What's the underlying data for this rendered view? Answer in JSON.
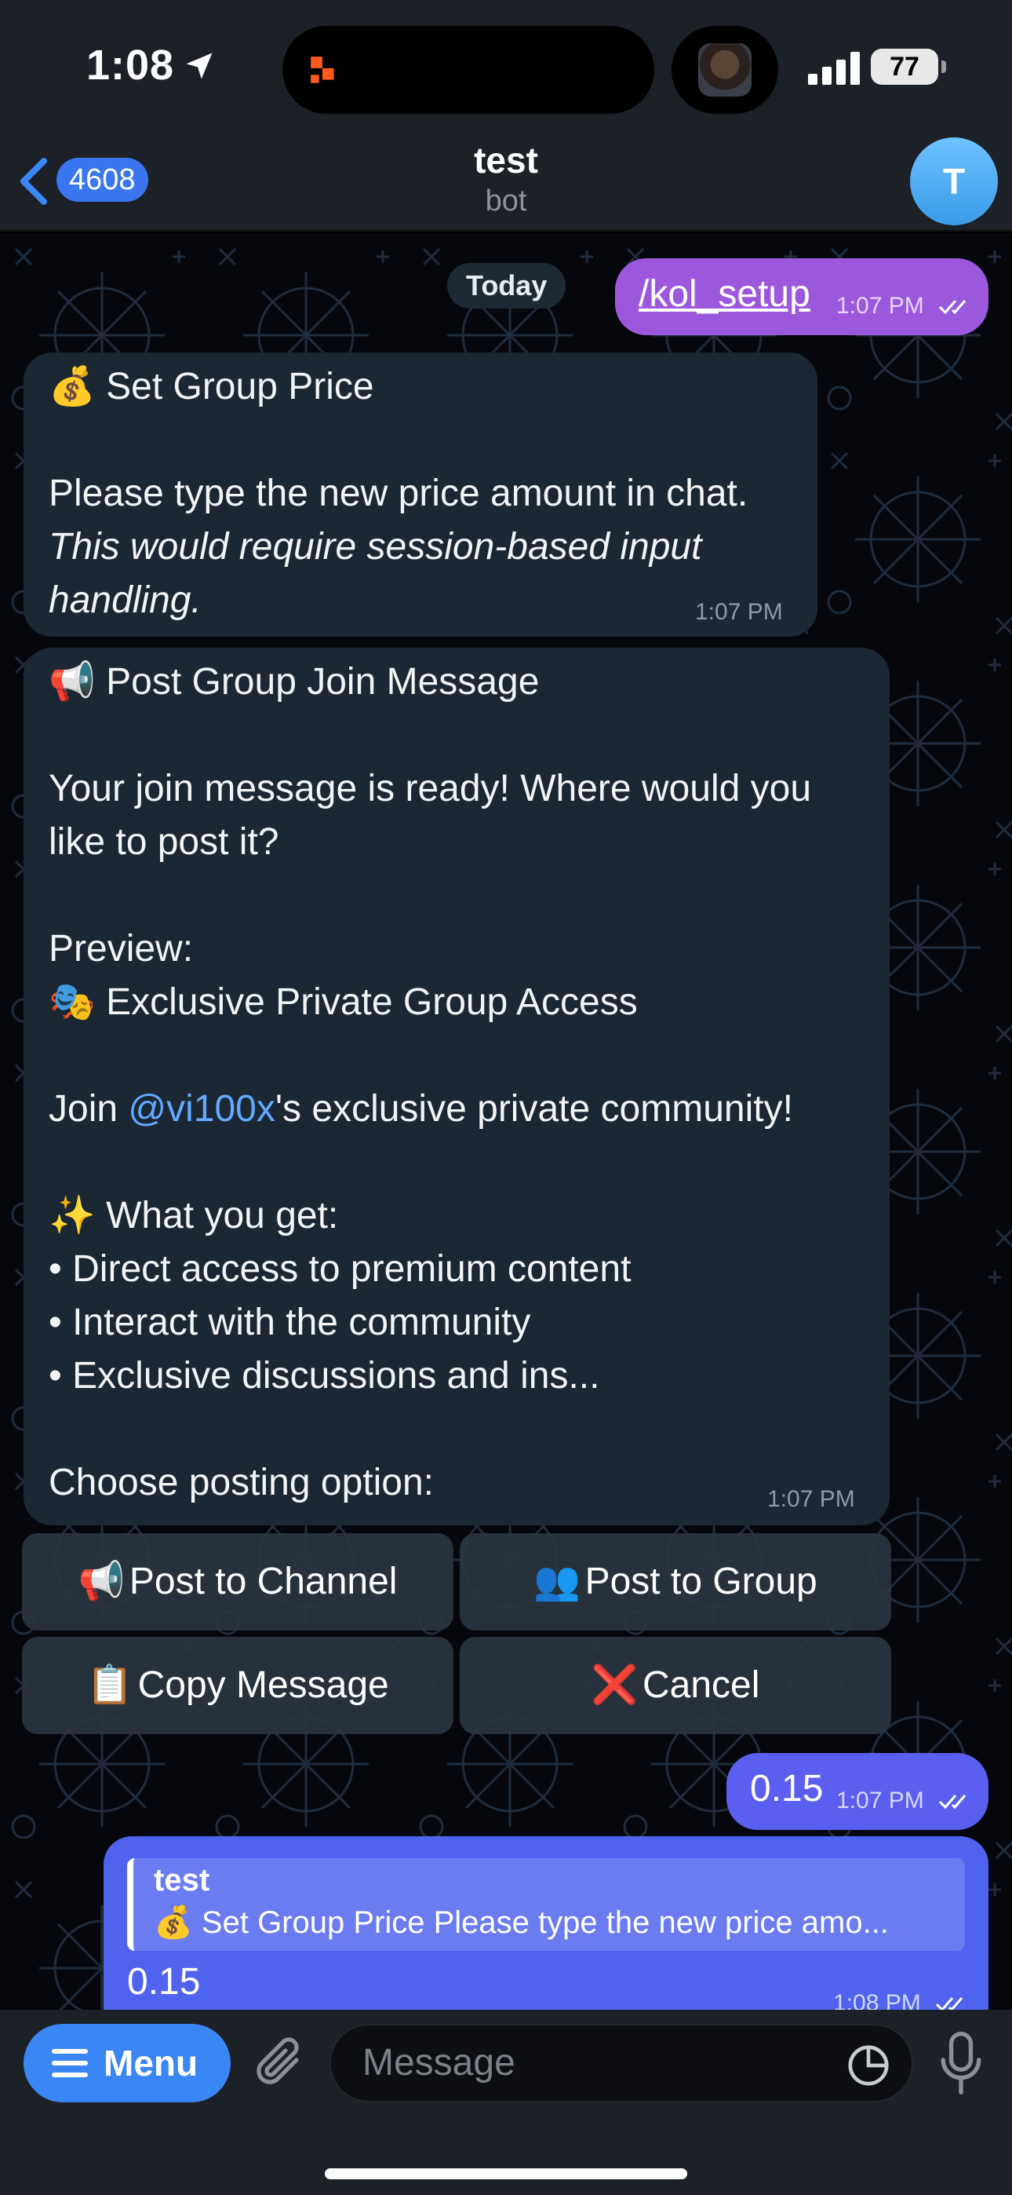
{
  "status": {
    "time": "1:08",
    "battery": "77"
  },
  "header": {
    "back_count": "4608",
    "title": "test",
    "subtitle": "bot",
    "avatar_initial": "T"
  },
  "chat": {
    "date_separator": "Today",
    "command_message": {
      "text": "/kol_setup",
      "time": "1:07 PM"
    },
    "price_message": {
      "title": "💰 Set Group Price",
      "line1": "Please type the new price amount in chat.",
      "italic_line1": "This would require session-based input",
      "italic_line2": "handling.",
      "time": "1:07 PM"
    },
    "join_message": {
      "title": "📢 Post Group Join Message",
      "line1": "Your join message is ready! Where would you",
      "line2": "like to post it?",
      "preview_label": "Preview:",
      "preview_title": "🎭 Exclusive Private Group Access",
      "join_prefix": "Join ",
      "mention": "@vi100x",
      "join_suffix": "'s exclusive private community!",
      "benefits_header": "✨ What you get:",
      "benefits": [
        "• Direct access to premium content",
        "• Interact with the community",
        "• Exclusive discussions and ins..."
      ],
      "choose_label": "Choose posting option:",
      "time": "1:07 PM"
    },
    "keyboard": [
      {
        "emoji": "📢",
        "label": "Post to Channel"
      },
      {
        "emoji": "👥",
        "label": "Post to Group"
      },
      {
        "emoji": "📋",
        "label": "Copy Message"
      },
      {
        "emoji": "❌",
        "label": "Cancel"
      }
    ],
    "price_reply": {
      "text": "0.15",
      "time": "1:07 PM"
    },
    "quoted_reply": {
      "quote_name": "test",
      "quote_text": "💰 Set Group Price Please type the new price amo...",
      "text": "0.15",
      "time": "1:08 PM"
    }
  },
  "input": {
    "menu_label": "Menu",
    "placeholder": "Message"
  },
  "colors": {
    "bar_bg": "#1c2027",
    "incoming_bubble": "#1b2733",
    "outgoing_bubble": "#8e54e9",
    "reply_bubble": "#4f63ee",
    "accent": "#3a86f5"
  }
}
